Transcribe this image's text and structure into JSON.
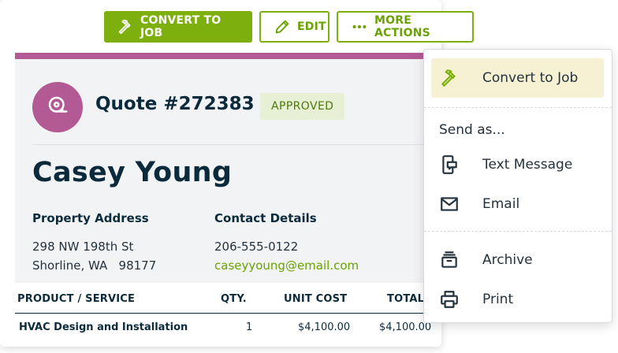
{
  "toolbar": {
    "convert_label": "CONVERT TO JOB",
    "edit_label": "EDIT",
    "more_label": "MORE ACTIONS"
  },
  "quote": {
    "title": "Quote #272383",
    "status": "APPROVED",
    "client_name": "Casey Young",
    "accent_color": "#b35a94",
    "property": {
      "heading": "Property Address",
      "line1": "298 NW 198th St",
      "line2": "Shorline, WA   98177"
    },
    "contact": {
      "heading": "Contact Details",
      "phone": "206-555-0122",
      "email": "caseyyoung@email.com"
    }
  },
  "table": {
    "headers": {
      "product": "PRODUCT / SERVICE",
      "qty": "QTY.",
      "unit_cost": "UNIT COST",
      "total": "TOTAL"
    },
    "rows": [
      {
        "product": "HVAC Design and Installation",
        "qty": "1",
        "unit_cost": "$4,100.00",
        "total": "$4,100.00"
      }
    ]
  },
  "menu": {
    "convert": {
      "label": "Convert to Job",
      "icon": "hammer-icon"
    },
    "send_as_label": "Send as...",
    "text_message": {
      "label": "Text Message",
      "icon": "phone-message-icon"
    },
    "email": {
      "label": "Email",
      "icon": "envelope-icon"
    },
    "archive": {
      "label": "Archive",
      "icon": "archive-box-icon"
    },
    "print": {
      "label": "Print",
      "icon": "printer-icon"
    }
  },
  "colors": {
    "brand_green": "#7db00e",
    "approved_bg": "#e7f0d5",
    "highlight_bg": "#f6f1d2",
    "text_dark": "#0b2b3c"
  }
}
